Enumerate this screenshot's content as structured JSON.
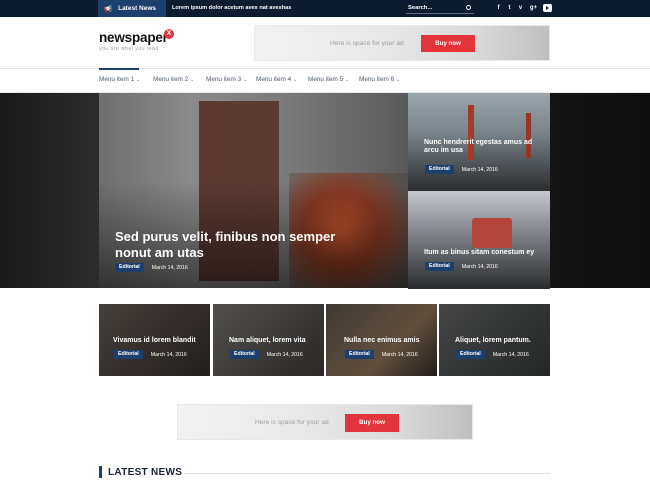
{
  "topbar": {
    "latest_label": "Latest News",
    "ticker": "Lorem ipsum dolor acetum aves nat aveshas",
    "search_placeholder": "Search...",
    "social": [
      "f",
      "t",
      "v",
      "g+",
      "yt"
    ]
  },
  "header": {
    "logo": "newspaper",
    "logo_mark": "X",
    "tagline": "you are what you read",
    "ad_text": "Here is space for your ad",
    "ad_button": "Buy now"
  },
  "nav": {
    "items": [
      "Menu item 1",
      "Menu item 2",
      "Menu item 3",
      "Menu item 4",
      "Menu item 5",
      "Menu item 6"
    ]
  },
  "featured": {
    "main": {
      "title": "Sed purus velit, finibus non semper nonut am utas",
      "category": "Editorial",
      "date": "March 14, 2016"
    },
    "side": [
      {
        "title": "Nunc hendrerit egestas amus ad arcu im usa",
        "category": "Editorial",
        "date": "March 14, 2016"
      },
      {
        "title": "Itum as binus sitam conestum ey",
        "category": "Editorial",
        "date": "March 14, 2016"
      }
    ]
  },
  "grid": [
    {
      "title": "Vivamus id lorem blandit",
      "category": "Editorial",
      "date": "March 14, 2016"
    },
    {
      "title": "Nam aliquet, lorem vita",
      "category": "Editorial",
      "date": "March 14, 2016"
    },
    {
      "title": "Nulla nec enimus amis",
      "category": "Editorial",
      "date": "March 14, 2016"
    },
    {
      "title": "Aliquet, lorem pantum.",
      "category": "Editorial",
      "date": "March 14, 2016"
    }
  ],
  "banner": {
    "ad_text": "Here is space for your ad",
    "ad_button": "Buy now"
  },
  "section": {
    "title": "LATEST NEWS"
  },
  "colors": {
    "navy": "#1c3f6e",
    "topbar": "#0d1b2e",
    "accent_red": "#e2343a"
  }
}
